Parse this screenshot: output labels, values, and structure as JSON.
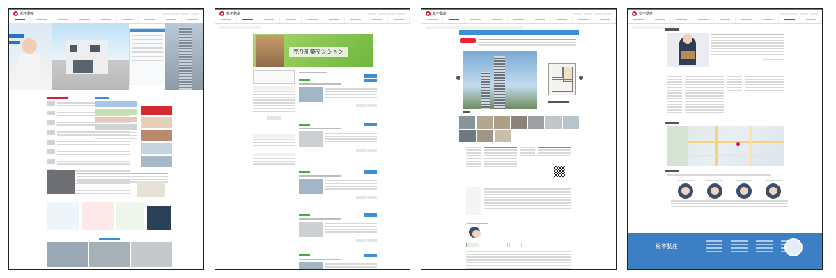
{
  "company": {
    "name": "松不動産",
    "name_footer": "松不動産",
    "brand_color": "#d81c3a",
    "accent_color": "#3c8fd6"
  },
  "screens": [
    {
      "name": "top-page"
    },
    {
      "name": "new-condo-list-page",
      "banner_title": "売り新築マンション"
    },
    {
      "name": "property-detail-page"
    },
    {
      "name": "company-profile-page"
    }
  ],
  "icons": [
    "logo-mark-icon",
    "prev-arrow-icon",
    "next-arrow-icon",
    "qr-code-icon",
    "map-pin-icon",
    "badge-icon"
  ]
}
